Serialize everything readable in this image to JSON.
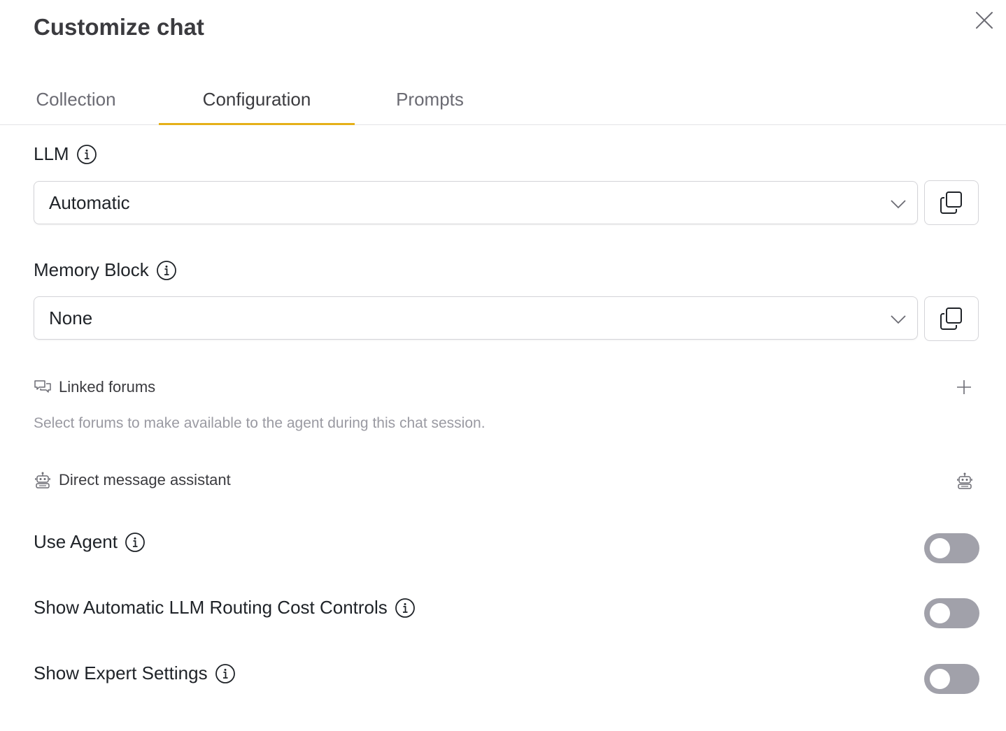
{
  "dialog": {
    "title": "Customize chat",
    "close_icon": "close-icon"
  },
  "tabs": [
    {
      "label": "Collection",
      "active": false
    },
    {
      "label": "Configuration",
      "active": true
    },
    {
      "label": "Prompts",
      "active": false
    }
  ],
  "accent_color": "#e5b019",
  "llm": {
    "label": "LLM",
    "selected": "Automatic"
  },
  "memory_block": {
    "label": "Memory Block",
    "selected": "None"
  },
  "linked_forums": {
    "label": "Linked forums",
    "description": "Select forums to make available to the agent during this chat session."
  },
  "direct_message": {
    "label": "Direct message assistant"
  },
  "toggles": [
    {
      "label": "Use Agent",
      "on": false
    },
    {
      "label": "Show Automatic LLM Routing Cost Controls",
      "on": false
    },
    {
      "label": "Show Expert Settings",
      "on": false
    }
  ],
  "toggle_off_color": "#a1a1aa"
}
